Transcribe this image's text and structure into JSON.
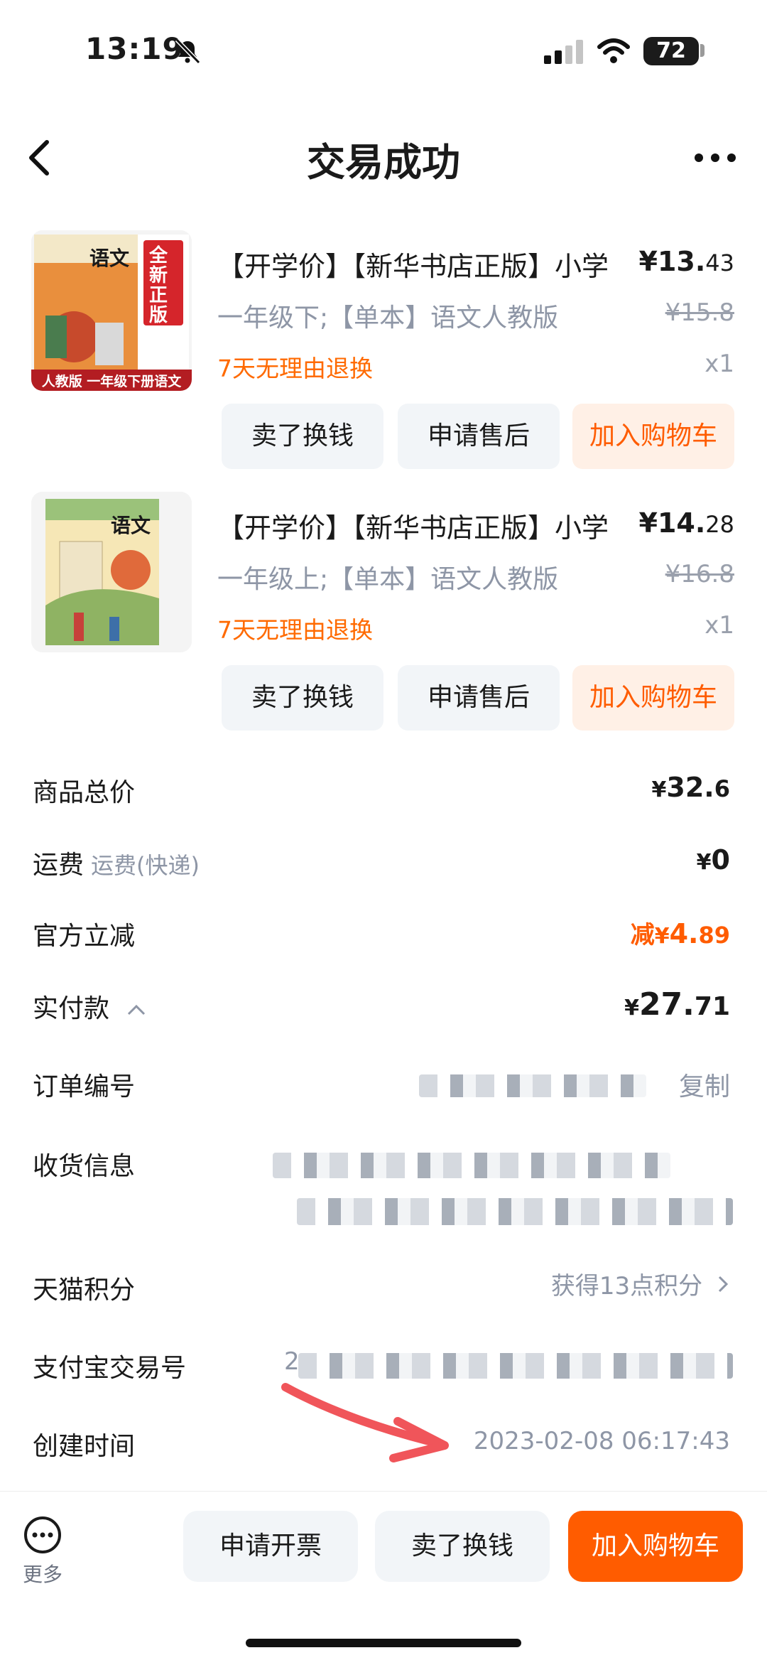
{
  "status_bar": {
    "time": "13:19",
    "battery": "72"
  },
  "header": {
    "title": "交易成功"
  },
  "products": [
    {
      "title": "【开学价】【新华书店正版】小学",
      "spec": "一年级下;【单本】语文人教版",
      "tag": "7天无理由退换",
      "price_int": "¥13.",
      "price_dec": "43",
      "original_price": "¥15.8",
      "qty": "x1",
      "cover_text": "语文",
      "cover_badge": "全新正版",
      "cover_bottom": "人教版 一年级下册语文",
      "buttons": [
        "卖了换钱",
        "申请售后",
        "加入购物车"
      ]
    },
    {
      "title": "【开学价】【新华书店正版】小学",
      "spec": "一年级上;【单本】语文人教版",
      "tag": "7天无理由退换",
      "price_int": "¥14.",
      "price_dec": "28",
      "original_price": "¥16.8",
      "qty": "x1",
      "cover_text": "语文",
      "buttons": [
        "卖了换钱",
        "申请售后",
        "加入购物车"
      ]
    }
  ],
  "summary": {
    "goods_total_label": "商品总价",
    "goods_total_cur": "¥",
    "goods_total_int": "32.",
    "goods_total_dec": "6",
    "shipping_label": "运费",
    "shipping_sub": "运费(快递)",
    "shipping_cur": "¥",
    "shipping_val": "0",
    "discount_label": "官方立减",
    "discount_prefix": "减",
    "discount_cur": "¥",
    "discount_int": "4.",
    "discount_dec": "89",
    "paid_label": "实付款",
    "paid_cur": "¥",
    "paid_int": "27.",
    "paid_dec": "71",
    "order_label": "订单编号",
    "order_copy": "复制",
    "address_label": "收货信息",
    "points_label": "天猫积分",
    "points_value": "获得13点积分",
    "alipay_label": "支付宝交易号",
    "alipay_prefix": "2",
    "created_label": "创建时间",
    "created_value": "2023-02-08 06:17:43"
  },
  "bottom_bar": {
    "more_label": "更多",
    "buttons": [
      "申请开票",
      "卖了换钱",
      "加入购物车"
    ]
  },
  "colors": {
    "accent": "#ff5c00",
    "muted": "#8e96a6",
    "annotation_arrow": "#f0555a"
  }
}
